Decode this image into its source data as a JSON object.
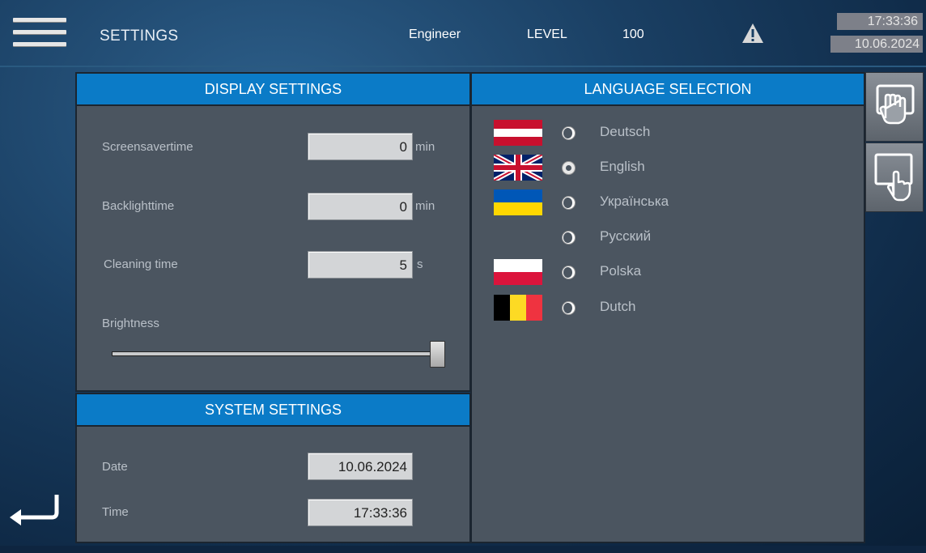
{
  "header": {
    "title": "SETTINGS",
    "user": "Engineer",
    "level_label": "LEVEL",
    "level_value": "100",
    "time": "17:33:36",
    "date": "10.06.2024"
  },
  "display": {
    "title": "DISPLAY SETTINGS",
    "screensaver_label": "Screensavertime",
    "screensaver_value": "0",
    "screensaver_unit": "min",
    "backlight_label": "Backlighttime",
    "backlight_value": "0",
    "backlight_unit": "min",
    "cleaning_label": "Cleaning time",
    "cleaning_value": "5",
    "cleaning_unit": "s",
    "brightness_label": "Brightness",
    "brightness_level": 1.0
  },
  "system": {
    "title": "SYSTEM SETTINGS",
    "date_label": "Date",
    "date_value": "10.06.2024",
    "time_label": "Time",
    "time_value": "17:33:36"
  },
  "language": {
    "title": "LANGUAGE SELECTION",
    "options": [
      {
        "label": "Deutsch",
        "selected": false
      },
      {
        "label": "English",
        "selected": true
      },
      {
        "label": "Українська",
        "selected": false
      },
      {
        "label": "Русский",
        "selected": false
      },
      {
        "label": "Polska",
        "selected": false
      },
      {
        "label": "Dutch",
        "selected": false
      }
    ]
  },
  "icons": {
    "menu": "hamburger-menu-icon",
    "warning": "warning-triangle-icon",
    "side1": "hand-touch-block-icon",
    "side2": "touch-screen-icon",
    "back": "return-arrow-icon"
  },
  "colors": {
    "accent": "#0b7bc7",
    "panel": "#4b5560"
  }
}
